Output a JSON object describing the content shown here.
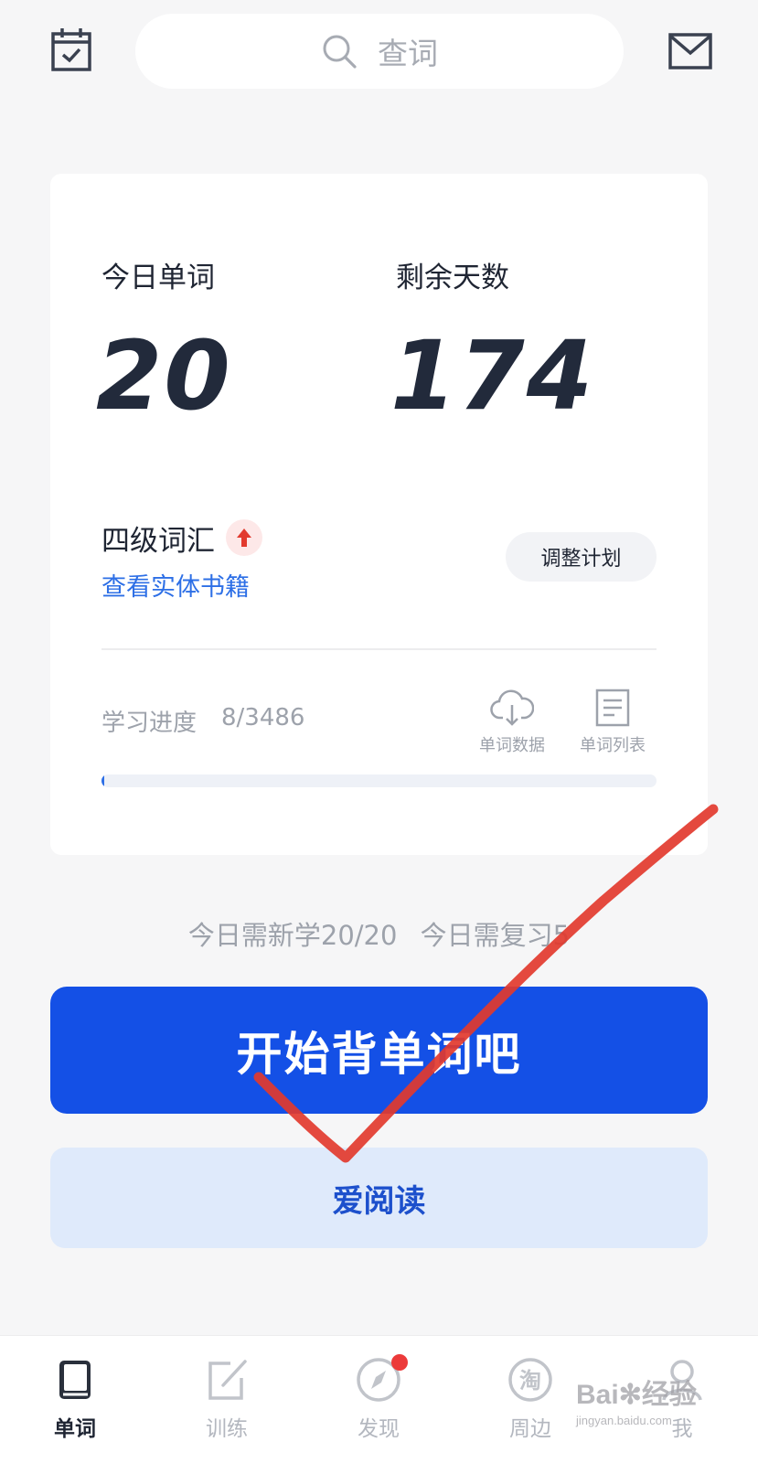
{
  "search": {
    "placeholder": "查词"
  },
  "stats": {
    "today_words_label": "今日单词",
    "today_words_value": "20",
    "remaining_days_label": "剩余天数",
    "remaining_days_value": "174"
  },
  "book": {
    "title": "四级词汇",
    "link": "查看实体书籍",
    "adjust_plan": "调整计划"
  },
  "progress": {
    "label": "学习进度",
    "value": "8/3486",
    "fraction": 0.0023
  },
  "tools": [
    {
      "label": "单词数据",
      "icon": "cloud-download-icon"
    },
    {
      "label": "单词列表",
      "icon": "document-list-icon"
    }
  ],
  "daily": {
    "new": "今日需新学20/20",
    "review": "今日需复习5"
  },
  "buttons": {
    "start": "开始背单词吧",
    "read": "爱阅读"
  },
  "tabs": [
    {
      "label": "单词",
      "icon": "book-icon",
      "active": true
    },
    {
      "label": "训练",
      "icon": "edit-icon",
      "active": false
    },
    {
      "label": "发现",
      "icon": "compass-icon",
      "active": false,
      "badge": true
    },
    {
      "label": "周边",
      "icon": "taobao-icon",
      "active": false,
      "glyph": "淘"
    },
    {
      "label": "我",
      "icon": "user-icon",
      "active": false
    }
  ],
  "watermark": {
    "brand": "Bai",
    "tail": "经验",
    "url": "jingyan.baidu.com"
  },
  "colors": {
    "primary": "#1450e6",
    "link": "#2d6fe6",
    "annotation": "#e23a2e",
    "badge": "#ec3a3a"
  }
}
